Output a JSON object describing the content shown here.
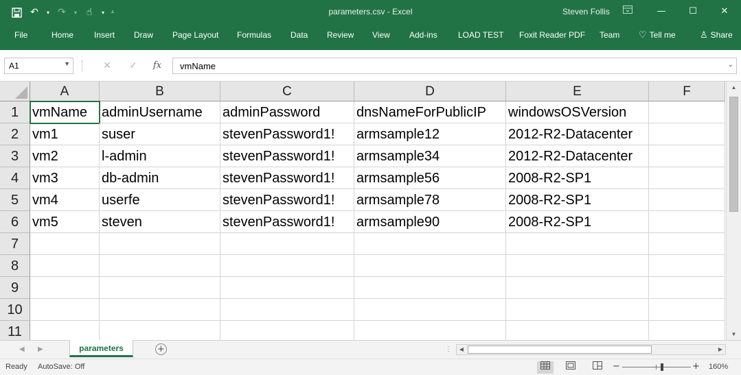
{
  "window": {
    "title": "parameters.csv  -  Excel",
    "user": "Steven Follis",
    "controls": [
      "ribbon-display-icon",
      "minimize-icon",
      "maximize-icon",
      "close-icon"
    ]
  },
  "quick_access": {
    "icons": [
      "save-icon",
      "undo-icon",
      "redo-icon",
      "touch-mode-icon",
      "customize-icon"
    ]
  },
  "ribbon": {
    "tabs": [
      "File",
      "Home",
      "Insert",
      "Draw",
      "Page Layout",
      "Formulas",
      "Data",
      "Review",
      "View",
      "Add-ins",
      "LOAD TEST",
      "Foxit Reader PDF",
      "Team"
    ],
    "tell_me": "Tell me",
    "share": "Share"
  },
  "formula_bar": {
    "name_box": "A1",
    "cancel_glyph": "✕",
    "enter_glyph": "✓",
    "fx_glyph": "fx",
    "value": "vmName"
  },
  "grid": {
    "columns": [
      "A",
      "B",
      "C",
      "D",
      "E",
      "F"
    ],
    "rows": [
      "1",
      "2",
      "3",
      "4",
      "5",
      "6",
      "7",
      "8",
      "9",
      "10",
      "11"
    ],
    "cells": [
      [
        "vmName",
        "adminUsername",
        "adminPassword",
        "dnsNameForPublicIP",
        "windowsOSVersion",
        ""
      ],
      [
        "vm1",
        "suser",
        "stevenPassword1!",
        "armsample12",
        "2012-R2-Datacenter",
        ""
      ],
      [
        "vm2",
        "l-admin",
        "stevenPassword1!",
        "armsample34",
        "2012-R2-Datacenter",
        ""
      ],
      [
        "vm3",
        "db-admin",
        "stevenPassword1!",
        "armsample56",
        "2008-R2-SP1",
        ""
      ],
      [
        "vm4",
        "userfe",
        "stevenPassword1!",
        "armsample78",
        "2008-R2-SP1",
        ""
      ],
      [
        "vm5",
        "steven",
        "stevenPassword1!",
        "armsample90",
        "2008-R2-SP1",
        ""
      ],
      [
        "",
        "",
        "",
        "",
        "",
        ""
      ],
      [
        "",
        "",
        "",
        "",
        "",
        ""
      ],
      [
        "",
        "",
        "",
        "",
        "",
        ""
      ],
      [
        "",
        "",
        "",
        "",
        "",
        ""
      ],
      [
        "",
        "",
        "",
        "",
        "",
        ""
      ]
    ],
    "selected_cell": "A1"
  },
  "sheets": {
    "tabs": [
      "parameters"
    ],
    "active": "parameters"
  },
  "status_bar": {
    "mode": "Ready",
    "autosave": "AutoSave: Off",
    "zoom": "160%",
    "zoom_minus": "−",
    "zoom_plus": "+"
  },
  "colors": {
    "brand": "#217346",
    "header_bg": "#e6e6e6",
    "gridline": "#d4d4d4"
  }
}
